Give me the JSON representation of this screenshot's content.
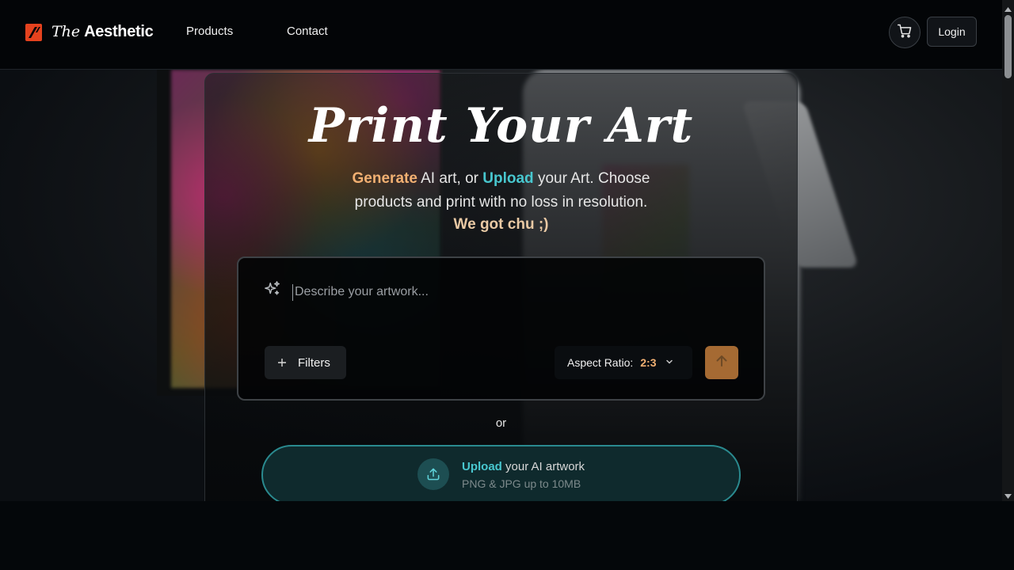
{
  "header": {
    "brand_the": "The",
    "brand_name": "Aesthetic",
    "nav": [
      "Products",
      "Contact"
    ],
    "login_label": "Login",
    "cart_icon": "shopping-cart-icon"
  },
  "hero": {
    "title": "Print Your Art",
    "sub_gen": "Generate",
    "sub_mid1": " AI art, or ",
    "sub_upload": "Upload",
    "sub_mid2": " your Art. Choose",
    "sub_line2": "products and print with no loss in resolution.",
    "tagline": "We got chu ;)"
  },
  "prompt": {
    "placeholder": "Describe your artwork...",
    "filters_label": "Filters",
    "aspect_label": "Aspect Ratio:",
    "aspect_value": "2:3",
    "icons": [
      "sparkles-icon",
      "plus-icon",
      "chevron-down-icon",
      "arrow-up-icon"
    ]
  },
  "divider_or": "or",
  "upload": {
    "keyword": "Upload",
    "title_rest": " your AI artwork",
    "subtitle": "PNG & JPG up to 10MB",
    "icon": "upload-icon"
  },
  "colors": {
    "accent_orange": "#f2b072",
    "accent_teal": "#48c7cf",
    "logo_red": "#e5421e",
    "send_button": "#a56a33"
  }
}
